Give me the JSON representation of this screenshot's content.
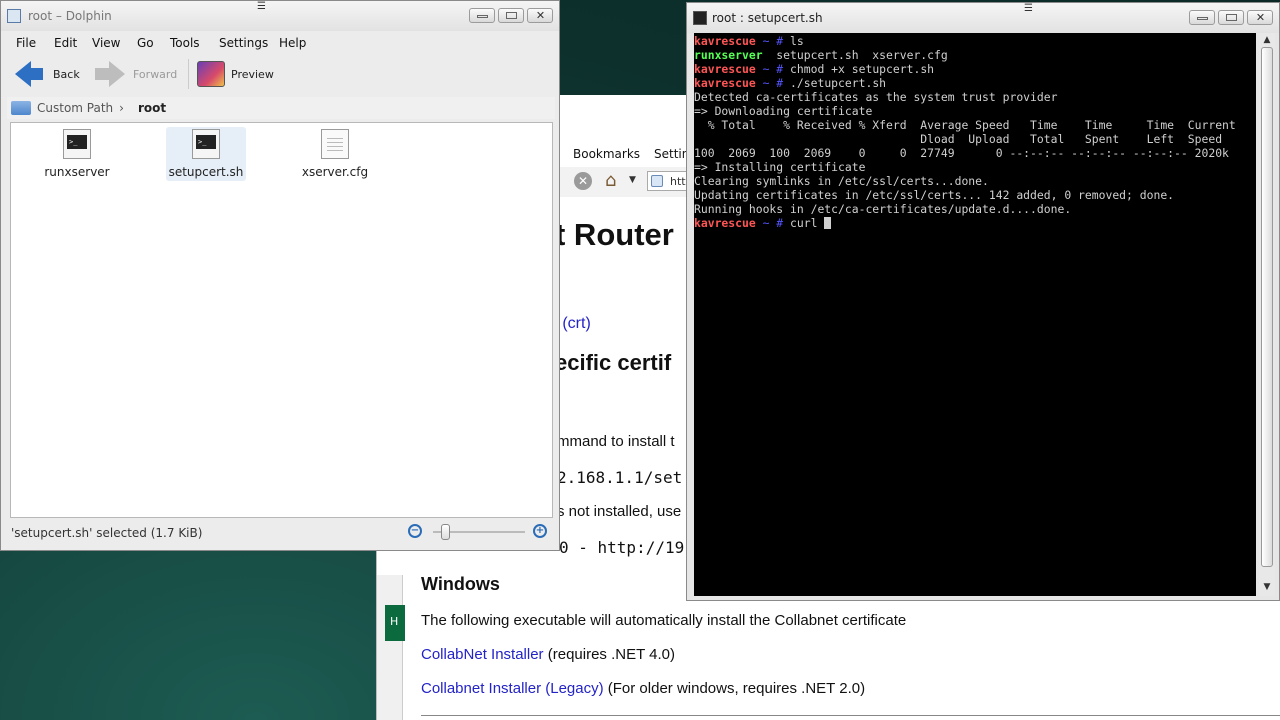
{
  "browser": {
    "menu": {
      "bookmarks": "Bookmarks",
      "settings": "Settin"
    },
    "url_fragment": "htt",
    "green_tab": "H",
    "content": {
      "heading": "t Router",
      "crt_link": "d (crt)",
      "subheading": "ecific certif",
      "para1": "mmand to install t",
      "code1": "2.168.1.1/set",
      "para2": "s not installed, use",
      "code2": "0 - http://19",
      "windows_heading": "Windows",
      "windows_text": "The following executable will automatically install the Collabnet certificate",
      "installer_link": "CollabNet Installer",
      "installer_note": " (requires .NET 4.0)",
      "legacy_link": "Collabnet Installer (Legacy)",
      "legacy_note": " (For older windows, requires .NET 2.0)"
    }
  },
  "dolphin": {
    "title": "root – Dolphin",
    "menu": [
      "File",
      "Edit",
      "View",
      "Go",
      "Tools",
      "Settings",
      "Help"
    ],
    "toolbar": {
      "back": "Back",
      "forward": "Forward",
      "preview": "Preview"
    },
    "breadcrumb": {
      "parent": "Custom Path",
      "current": "root"
    },
    "files": [
      {
        "name": "runxserver",
        "type": "script"
      },
      {
        "name": "setupcert.sh",
        "type": "script"
      },
      {
        "name": "xserver.cfg",
        "type": "text"
      }
    ],
    "status": "'setupcert.sh' selected (1.7 KiB)"
  },
  "terminal": {
    "title": "root : setupcert.sh",
    "prompt_user": "kavrescue",
    "prompt_path": " ~ # ",
    "lines": {
      "cmd_ls": "ls",
      "ls_green": "runxserver",
      "ls_rest": "  setupcert.sh  xserver.cfg",
      "cmd_chmod": "chmod +x setupcert.sh",
      "cmd_run": "./setupcert.sh",
      "out1": "Detected ca-certificates as the system trust provider",
      "out2": "=> Downloading certificate",
      "out3": "  % Total    % Received % Xferd  Average Speed   Time    Time     Time  Current",
      "out4": "                                 Dload  Upload   Total   Spent    Left  Speed",
      "out5": "100  2069  100  2069    0     0  27749      0 --:--:-- --:--:-- --:--:-- 2020k",
      "out6": "=> Installing certificate",
      "out7": "Clearing symlinks in /etc/ssl/certs...done.",
      "out8": "Updating certificates in /etc/ssl/certs... 142 added, 0 removed; done.",
      "out9": "Running hooks in /etc/ca-certificates/update.d....done.",
      "cmd_curl": "curl "
    }
  }
}
